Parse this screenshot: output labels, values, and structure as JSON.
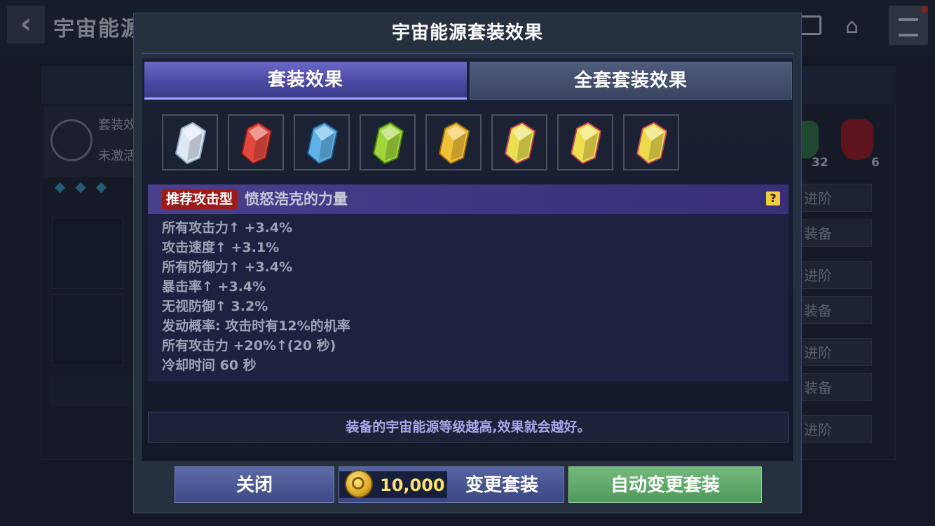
{
  "background": {
    "title": "宇宙能源",
    "card_label_1": "套装效",
    "card_label_2": "未激活",
    "counts": [
      "32",
      "6"
    ],
    "buttons": [
      "进阶",
      "装备",
      "进阶",
      "装备",
      "进阶",
      "装备",
      "进阶"
    ]
  },
  "modal": {
    "title": "宇宙能源套装效果",
    "tabs": [
      {
        "label": "套装效果",
        "active": true
      },
      {
        "label": "全套套装效果",
        "active": false
      }
    ],
    "gems": [
      {
        "name": "white-gem",
        "color": "#dfe9f3",
        "edge": "#8fa8c0"
      },
      {
        "name": "red-gem",
        "color": "#e2483e",
        "edge": "#8a1a16"
      },
      {
        "name": "blue-gem",
        "color": "#5fb2e6",
        "edge": "#235a8c"
      },
      {
        "name": "green-gem",
        "color": "#9fd63a",
        "edge": "#4c7e12"
      },
      {
        "name": "yellow-gem",
        "color": "#f0c038",
        "edge": "#9a6a10"
      },
      {
        "name": "rainbow-gem-1",
        "color": "#e8e050",
        "edge": "#c03a5a"
      },
      {
        "name": "rainbow-gem-2",
        "color": "#eede4e",
        "edge": "#c0405a"
      },
      {
        "name": "rainbow-gem-3",
        "color": "#ecdc4c",
        "edge": "#c8465c"
      }
    ],
    "set": {
      "badge": "推荐攻击型",
      "name": "愤怒浩克的力量",
      "help": "?",
      "stats": [
        "所有攻击力↑ +3.4%",
        "攻击速度↑ +3.1%",
        "所有防御力↑ +3.4%",
        "暴击率↑ +3.4%",
        "无视防御↑ 3.2%",
        "发动概率: 攻击时有12%的机率",
        "所有攻击力 +20%↑(20 秒)",
        "冷却时间 60 秒"
      ]
    },
    "note": "装备的宇宙能源等级越高,效果就会越好。",
    "buttons": {
      "close": "关闭",
      "price": "10,000",
      "change": "变更套装",
      "auto_change": "自动变更套装"
    }
  },
  "colors": {
    "badge_red": "#9c1c1c",
    "tab_active": "#5a57b6",
    "auto_button": "#5fa86a",
    "price_gold": "#ffe070"
  }
}
